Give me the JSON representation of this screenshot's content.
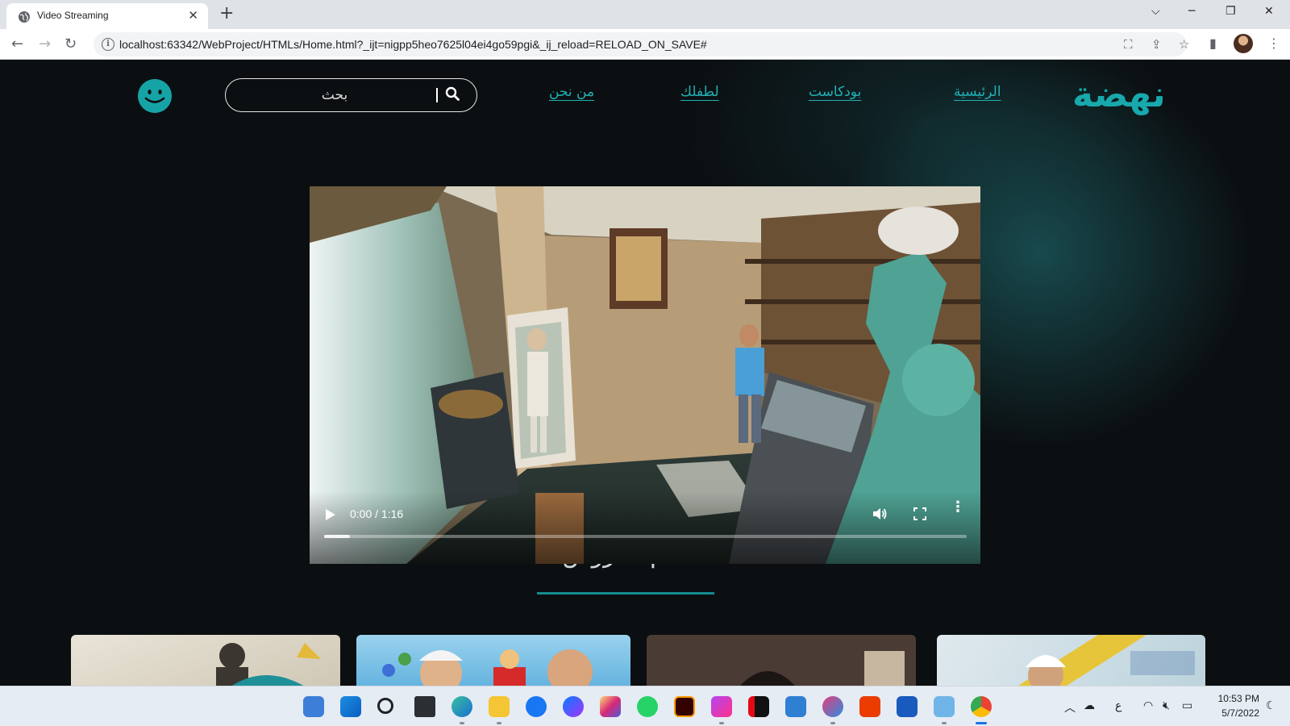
{
  "browser": {
    "tab_title": "Video Streaming",
    "url": "localhost:63342/WebProject/HTMLs/Home.html?_ijt=nigpp5heo7625l04ei4go59pgi&_ij_reload=RELOAD_ON_SAVE#"
  },
  "site": {
    "logo": "نهضة",
    "nav": [
      {
        "label": "الرئيسية"
      },
      {
        "label": "بودكاست"
      },
      {
        "label": "لطفلك"
      },
      {
        "label": "من نحن"
      }
    ],
    "search": {
      "placeholder": "بحث"
    },
    "section_title": "أهم العروض"
  },
  "video": {
    "time_display": "0:00 / 1:16",
    "progress_fraction": 0.04
  },
  "taskbar": {
    "icons": [
      "widgets-icon",
      "start-icon",
      "search-icon",
      "task-view-icon",
      "edge-icon",
      "file-explorer-icon",
      "facebook-icon",
      "messenger-icon",
      "instagram-icon",
      "whatsapp-icon",
      "illustrator-icon",
      "phpstorm-icon",
      "netflix-icon",
      "microsoft-store-icon",
      "snipping-tool-icon",
      "office-icon",
      "word-icon",
      "notepad-icon",
      "chrome-icon"
    ],
    "keyboard_lang": "ع",
    "time": "10:53 PM",
    "date": "5/7/2022"
  },
  "colors": {
    "accent": "#18a9ad",
    "page_bg": "#0b0f11"
  }
}
